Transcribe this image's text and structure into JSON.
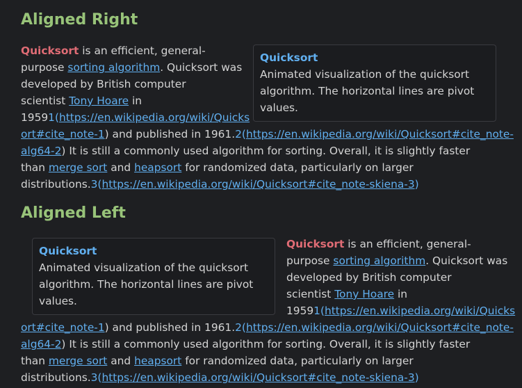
{
  "section_right": {
    "heading": "Aligned Right",
    "figure": {
      "title": "Quicksort",
      "caption_lines": [
        "Animated visualization of the quicksort",
        "algorithm. The horizontal lines are pivot",
        "values."
      ]
    }
  },
  "section_left": {
    "heading": "Aligned Left",
    "figure": {
      "title": "Quicksort",
      "caption_lines": [
        "Animated visualization of the quicksort",
        "algorithm. The horizontal lines are pivot",
        "values."
      ]
    }
  },
  "article": {
    "name": "Quicksort",
    "t1": " is an efficient, general-",
    "t2": "purpose ",
    "link_sorting": "sorting algorithm",
    "t3": ". Quicksort was",
    "t4": "developed by British computer",
    "t5": "scientist ",
    "link_hoare": "Tony Hoare",
    "t6": " in",
    "t7": "1959",
    "ref1": "1",
    "t_paren_open": "(",
    "url1_part1": "https://en.wikipedia.org/wiki/Quicks",
    "url1_part2": "ort#cite_note-1",
    "t8": ") and published in 1961.",
    "ref2": "2",
    "url2_part1": "https://en.wikipedia.org/wiki/Quicksort#cite_note-",
    "url2_part2": "alg64-2",
    "t9": ") It is still a commonly used algorithm for sorting. Overall, it is slightly faster",
    "t10": "than ",
    "link_merge": "merge sort",
    "t11": " and ",
    "link_heap": "heapsort",
    "t12": " for randomized data, particularly on larger",
    "t13": "distributions.",
    "ref3": "3",
    "url3": "https://en.wikipedia.org/wiki/Quicksort#cite_note-skiena-3",
    "t_paren_close": ")"
  }
}
